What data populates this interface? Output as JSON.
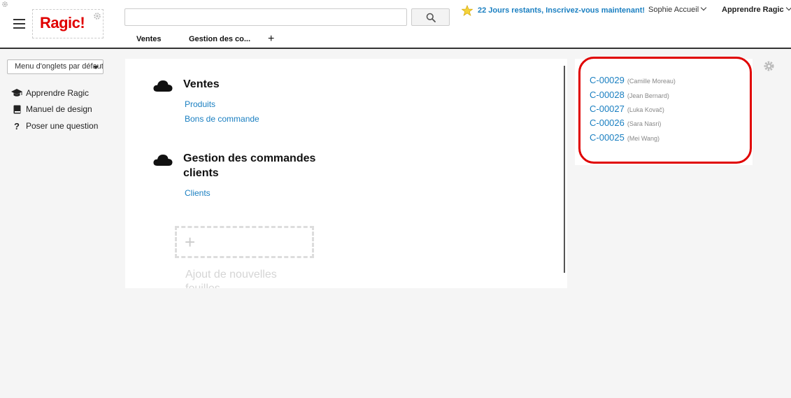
{
  "header": {
    "logo": "Ragic!",
    "search": {
      "value": "",
      "placeholder": ""
    },
    "trial_text": "22 Jours restants, Inscrivez-vous maintenant!",
    "user_menu": "Sophie Accueil",
    "learn_menu": "Apprendre Ragic",
    "tabs": [
      {
        "label": "Ventes"
      },
      {
        "label": "Gestion des co..."
      }
    ],
    "add_tab": "+"
  },
  "sidebar": {
    "tab_menu": "Menu d'onglets par défaut",
    "links": [
      {
        "label": "Apprendre Ragic",
        "icon": "graduation-cap-icon"
      },
      {
        "label": "Manuel de design",
        "icon": "book-icon"
      },
      {
        "label": "Poser une question",
        "icon": "question-icon"
      }
    ]
  },
  "main": {
    "sections": [
      {
        "title_line1": "Ventes",
        "title_line2": "",
        "sheets": [
          "Produits",
          "Bons de commande"
        ]
      },
      {
        "title_line1": "Gestion des commandes",
        "title_line2": "clients",
        "sheets": [
          "Clients"
        ]
      }
    ],
    "add_sheet_line1": "Ajout de nouvelles",
    "add_sheet_line2": "feuilles"
  },
  "recent": {
    "items": [
      {
        "id": "C-00029",
        "name": "(Camille Moreau)"
      },
      {
        "id": "C-00028",
        "name": "(Jean Bernard)"
      },
      {
        "id": "C-00027",
        "name": "(Luka Kovač)"
      },
      {
        "id": "C-00026",
        "name": "(Sara Nasri)"
      },
      {
        "id": "C-00025",
        "name": "(Mei Wang)"
      }
    ]
  },
  "colors": {
    "accent": "#1a7fc1",
    "logo": "#e00000",
    "highlight_ring": "#e00000"
  }
}
